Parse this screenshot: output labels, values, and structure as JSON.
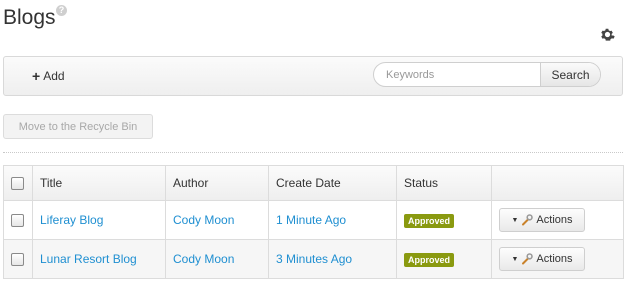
{
  "header": {
    "title": "Blogs",
    "help_icon": "question-icon",
    "help_glyph": "?",
    "settings_icon": "gear-icon"
  },
  "toolbar": {
    "add_label": "Add",
    "add_icon": "plus-icon",
    "search_placeholder": "Keywords",
    "search_value": "",
    "search_button_label": "Search"
  },
  "recycle_button_label": "Move to the Recycle Bin",
  "table": {
    "columns": [
      "Title",
      "Author",
      "Create Date",
      "Status"
    ],
    "rows": [
      {
        "title": "Liferay Blog",
        "author": "Cody Moon",
        "create_date": "1 Minute Ago",
        "status": "Approved",
        "actions_label": "Actions"
      },
      {
        "title": "Lunar Resort Blog",
        "author": "Cody Moon",
        "create_date": "3 Minutes Ago",
        "status": "Approved",
        "actions_label": "Actions"
      }
    ]
  },
  "colors": {
    "link": "#1f8fd1",
    "approved_badge": "#8a9a10",
    "disabled_text": "#a8a8a8"
  }
}
